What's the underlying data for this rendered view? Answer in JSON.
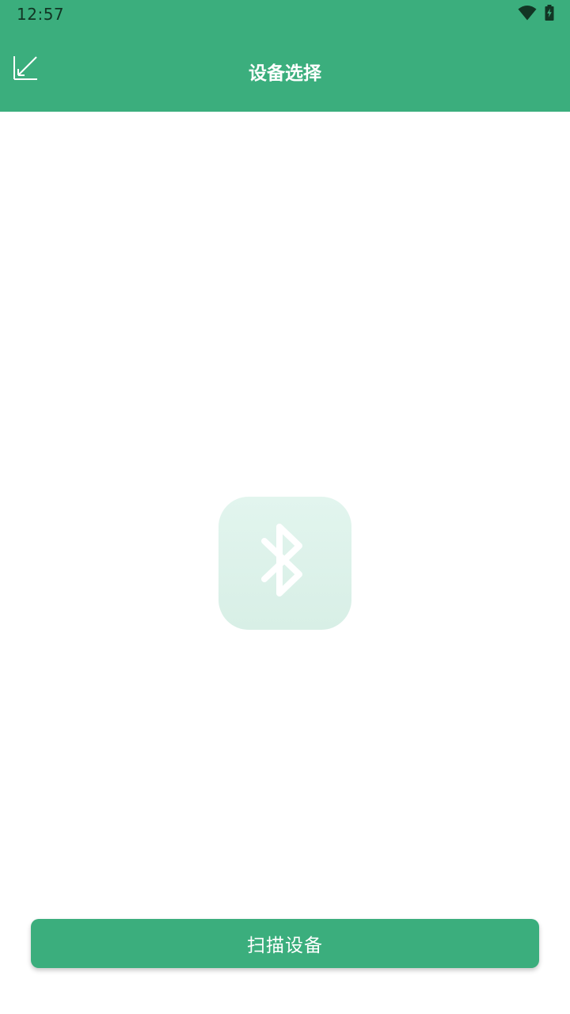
{
  "status_bar": {
    "time": "12:57",
    "icons": [
      "wifi-icon",
      "battery-charging-icon"
    ]
  },
  "app_bar": {
    "title": "设备选择",
    "back_icon": "collapse-arrow-icon"
  },
  "main": {
    "illustration_icon": "bluetooth-icon"
  },
  "actions": {
    "scan_label": "扫描设备"
  },
  "colors": {
    "primary": "#3bae7d",
    "status_text": "#123524",
    "tile_bg": "#e0f3ec",
    "background": "#ffffff"
  }
}
